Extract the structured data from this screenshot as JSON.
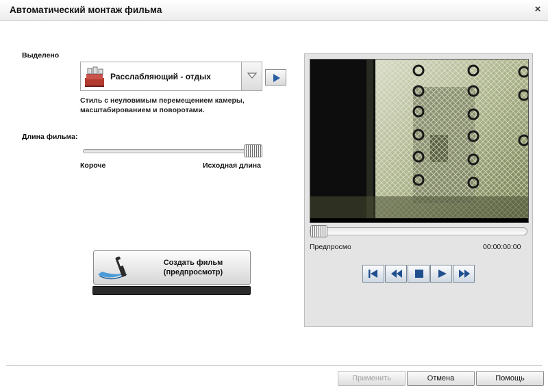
{
  "window": {
    "title": "Автоматический монтаж фильма",
    "close_glyph": "×"
  },
  "left": {
    "selected_label": "Выделено",
    "style_value": "Расслабляющий - отдых",
    "style_description": "Стиль с неуловимым перемещением камеры, масштабированием и поворотами.",
    "length_label": "Длина фильма:",
    "length_min_label": "Короче",
    "length_max_label": "Исходная длина",
    "length_value_fraction": 1.0,
    "create_button": {
      "line1": "Создать фильм",
      "line2": "(предпросмотр)"
    }
  },
  "preview": {
    "label": "Предпросмотр",
    "timecode": "00:00:00:00",
    "position_fraction": 0.0
  },
  "transport": {
    "first": "skip-to-start-icon",
    "rewind": "rewind-icon",
    "stop": "stop-icon",
    "play": "play-icon",
    "forward": "fast-forward-icon"
  },
  "buttons": {
    "apply": "Применить",
    "cancel": "Отмена",
    "help": "Помощь"
  },
  "colors": {
    "transport_icon": "#1f4f8f",
    "progress_bar": "#2a2a2a"
  }
}
